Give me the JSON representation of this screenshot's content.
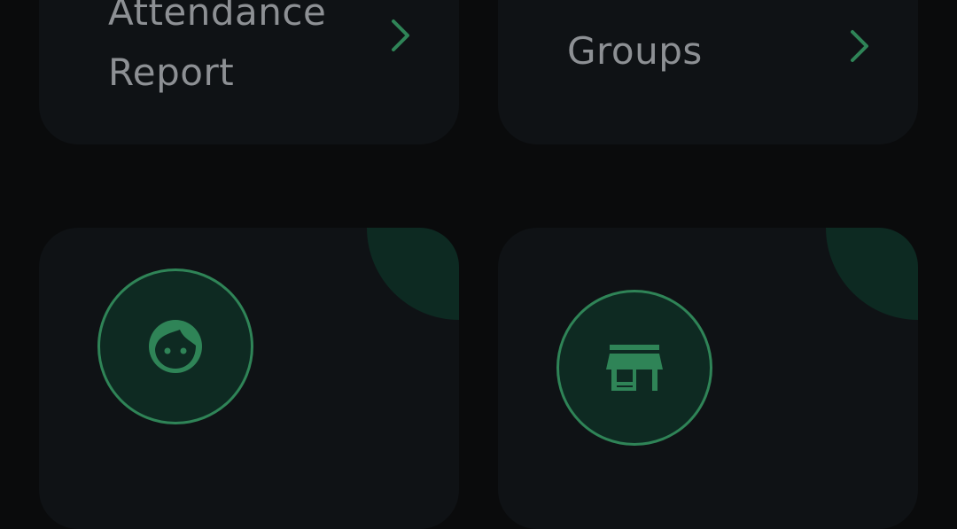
{
  "cards": {
    "attendance_report": {
      "label": "Attendance Report",
      "icon": "chevron-right-icon"
    },
    "groups": {
      "label": "Groups",
      "icon": "chevron-right-icon"
    },
    "students": {
      "icon": "face-icon"
    },
    "shop": {
      "icon": "storefront-icon"
    }
  },
  "colors": {
    "background": "#0a0b0c",
    "card": "#0f1215",
    "accent": "#2f8457",
    "accent_dark": "#0d2a22",
    "label_text": "#8d9094"
  }
}
